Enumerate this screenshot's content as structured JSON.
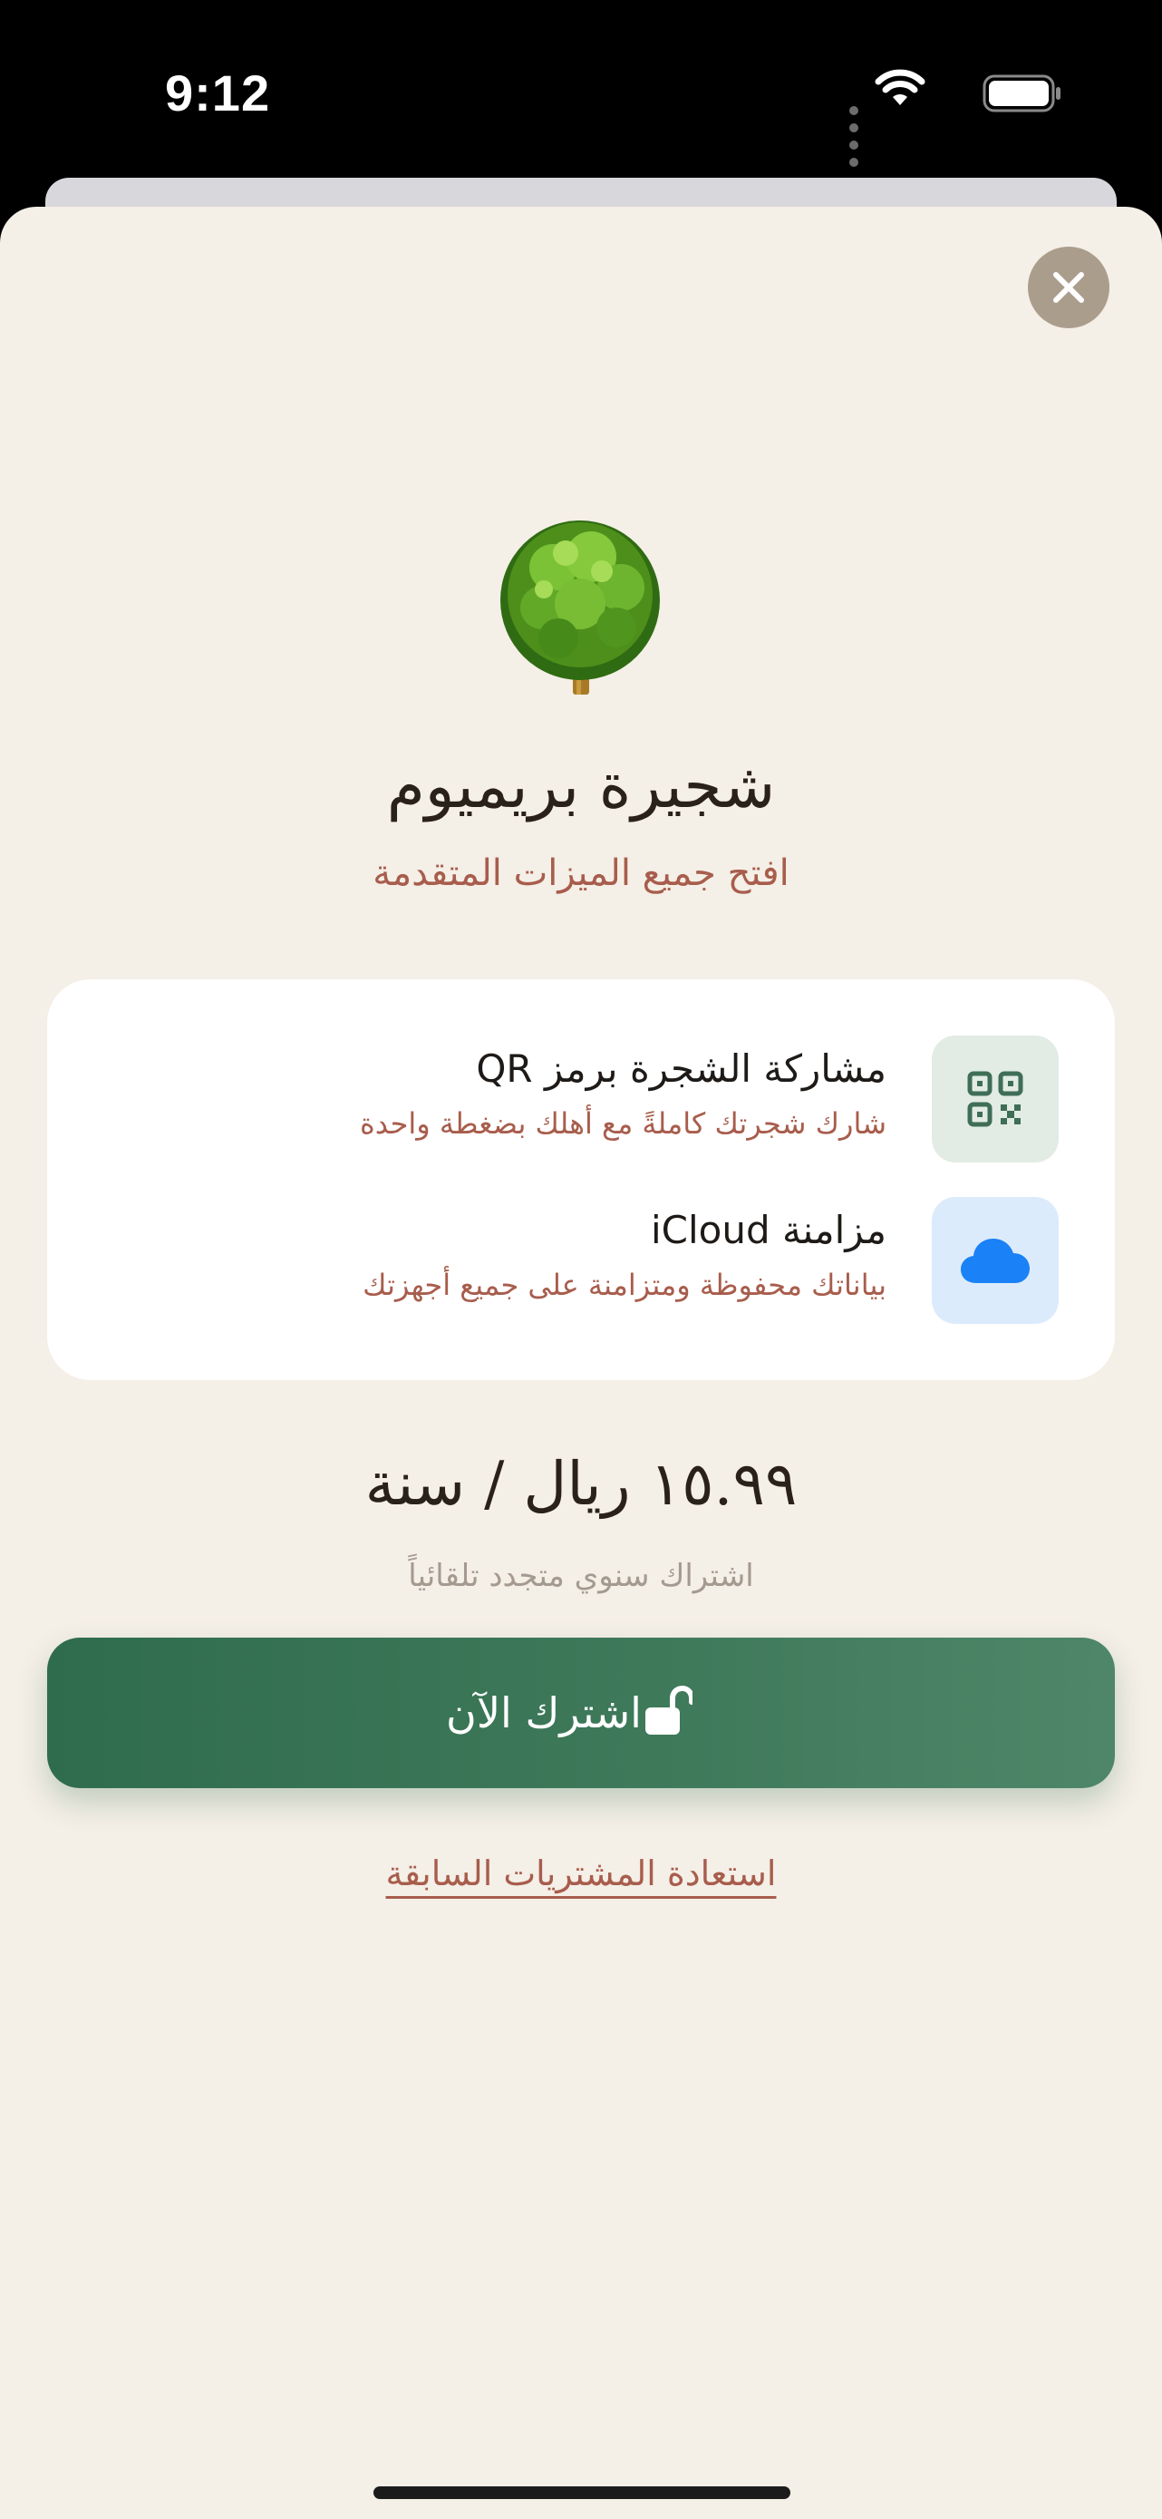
{
  "status_bar": {
    "time": "9:12"
  },
  "header": {
    "title": "شجيرة بريميوم",
    "subtitle": "افتح جميع الميزات المتقدمة"
  },
  "features": [
    {
      "title": "مشاركة الشجرة برمز QR",
      "description": "شارك شجرتك كاملةً مع أهلك بضغطة واحدة",
      "icon": "qr-code-icon",
      "icon_bg": "#e2ebe4",
      "icon_color": "#3f6e56"
    },
    {
      "title": "مزامنة iCloud",
      "description": "بياناتك محفوظة ومتزامنة على جميع أجهزتك",
      "icon": "cloud-icon",
      "icon_bg": "#dcebfb",
      "icon_color": "#1a82f6"
    }
  ],
  "pricing": {
    "price": "١٥.٩٩ ريال / سنة",
    "note": "اشتراك سنوي متجدد تلقائياً"
  },
  "actions": {
    "subscribe_label": "اشترك الآن",
    "restore_label": "استعادة المشتريات السابقة"
  },
  "colors": {
    "background": "#f4efe7",
    "accent_green": "#3a7656",
    "accent_rust": "#a85d4c",
    "close_button": "#ab9d8c"
  }
}
